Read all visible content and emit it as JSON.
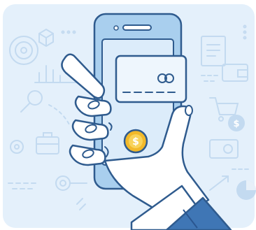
{
  "illustration": {
    "coin_symbol": "$",
    "floating_coin_symbol": "$",
    "colors": {
      "background": "#e4f0fb",
      "outline": "#2f5b8e",
      "phone_body": "#a9cfee",
      "screen": "#dcecfa",
      "card": "#eef6fd",
      "coin": "#f2b92a",
      "coin_inner": "#f8d35a",
      "sleeve": "#3f76b5",
      "cuff": "#ffffff",
      "skin": "#ffffff",
      "line_art": "#c3daf0"
    }
  }
}
